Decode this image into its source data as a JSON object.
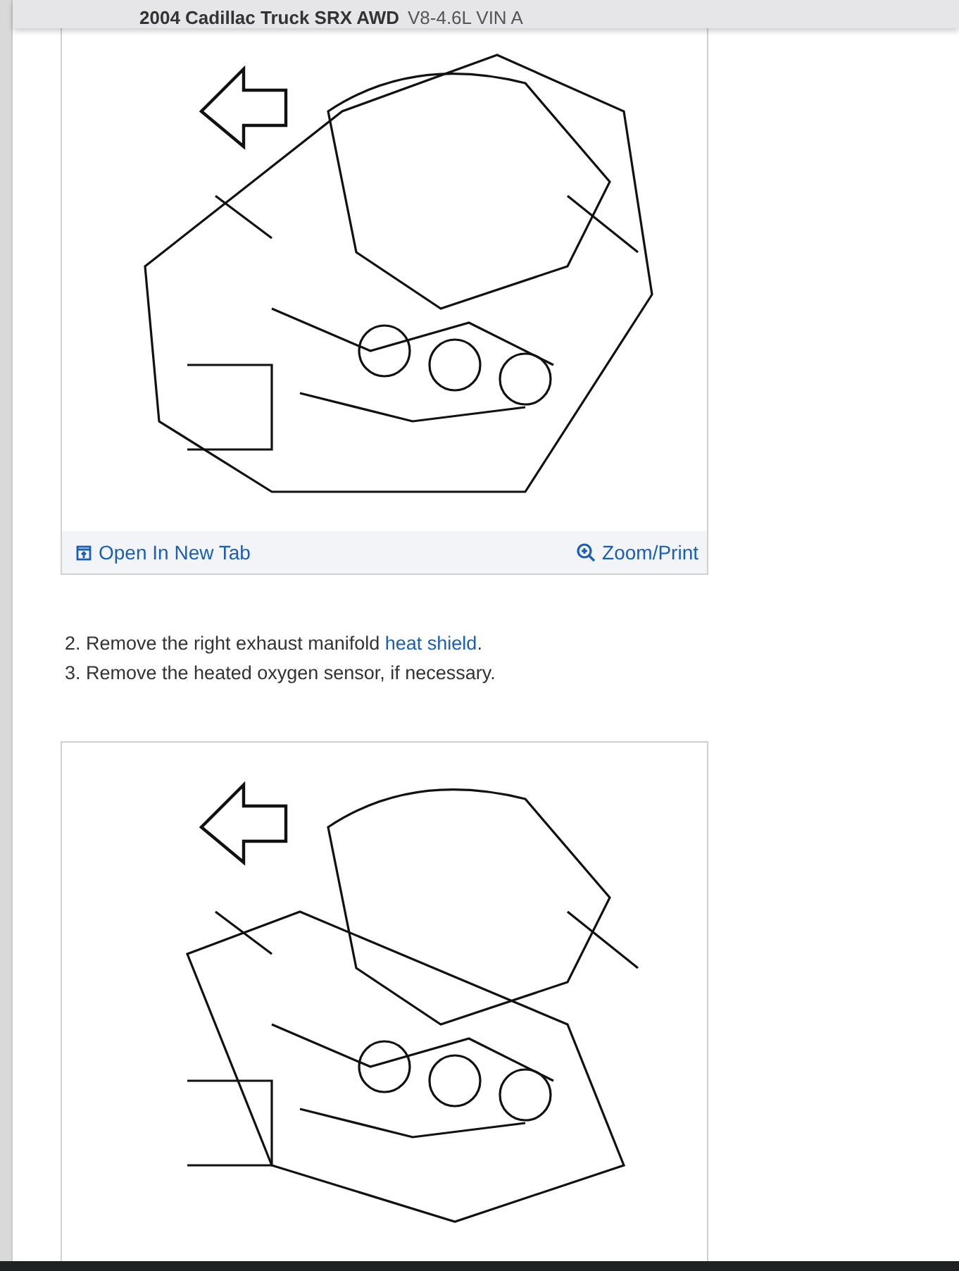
{
  "header": {
    "title_bold": "2004 Cadillac Truck SRX AWD",
    "title_rest": "V8-4.6L VIN A"
  },
  "figures": [
    {
      "actions": [
        {
          "kind": "open",
          "label": "Open In New Tab"
        },
        {
          "kind": "zoom",
          "label": "Zoom/Print"
        }
      ]
    }
  ],
  "steps": [
    {
      "text": "2. Remove the right exhaust manifold ",
      "link": "heat shield",
      "after": "."
    },
    {
      "text": "3. Remove the heated oxygen sensor, if necessary."
    }
  ]
}
